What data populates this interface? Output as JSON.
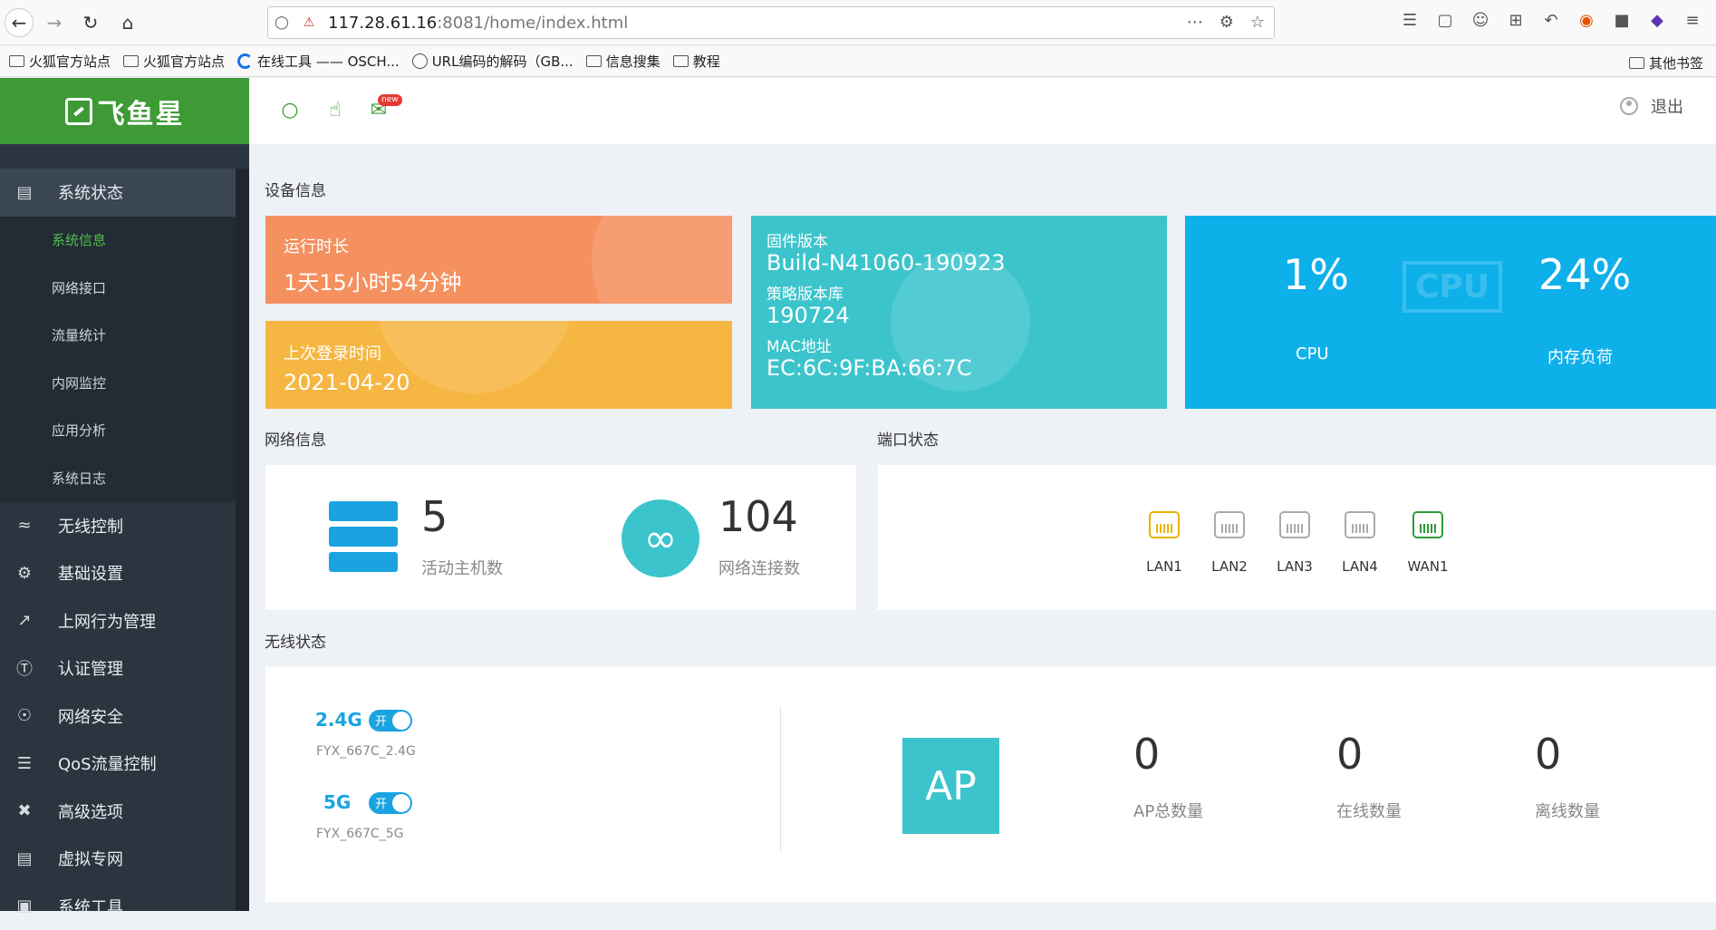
{
  "browser": {
    "url_host": "117.28.61.16",
    "url_rest": ":8081/home/index.html",
    "bookmarks": [
      {
        "label": "火狐官方站点",
        "icon": "folder-icon"
      },
      {
        "label": "火狐官方站点",
        "icon": "folder-icon"
      },
      {
        "label": "在线工具 —— OSCH...",
        "icon": "c-logo-icon"
      },
      {
        "label": "URL编码的解码（GB...",
        "icon": "globe-icon"
      },
      {
        "label": "信息搜集",
        "icon": "folder-icon"
      },
      {
        "label": "教程",
        "icon": "folder-icon"
      }
    ],
    "other_bookmarks": "其他书签"
  },
  "app": {
    "brand": "飞鱼星",
    "header": {
      "new_badge": "new",
      "logout": "退出"
    },
    "sidebar": {
      "items": [
        {
          "label": "系统状态",
          "icon": "monitor-icon"
        },
        {
          "label": "无线控制",
          "icon": "wifi-icon"
        },
        {
          "label": "基础设置",
          "icon": "gear-icon"
        },
        {
          "label": "上网行为管理",
          "icon": "chart-line-icon"
        },
        {
          "label": "认证管理",
          "icon": "v-circle-icon"
        },
        {
          "label": "网络安全",
          "icon": "shield-icon"
        },
        {
          "label": "QoS流量控制",
          "icon": "sliders-icon"
        },
        {
          "label": "高级选项",
          "icon": "tools-icon"
        },
        {
          "label": "虚拟专网",
          "icon": "vpn-icon"
        },
        {
          "label": "系统工具",
          "icon": "toolbox-icon"
        }
      ],
      "subitems": [
        "系统信息",
        "网络接口",
        "流量统计",
        "内网监控",
        "应用分析",
        "系统日志"
      ]
    },
    "device_info": {
      "title": "设备信息",
      "uptime_label": "运行时长",
      "uptime_value": "1天15小时54分钟",
      "last_login_label": "上次登录时间",
      "last_login_value": "2021-04-20",
      "firmware_label": "固件版本",
      "firmware_value": "Build-N41060-190923",
      "policy_label": "策略版本库",
      "policy_value": "190724",
      "mac_label": "MAC地址",
      "mac_value": "EC:6C:9F:BA:66:7C",
      "cpu_value": "1%",
      "cpu_label": "CPU",
      "mem_value": "24%",
      "mem_label": "内存负荷",
      "watermark": "CPU"
    },
    "network_info": {
      "title": "网络信息",
      "hosts_value": "5",
      "hosts_label": "活动主机数",
      "conn_value": "104",
      "conn_label": "网络连接数"
    },
    "port_status": {
      "title": "端口状态",
      "ports": [
        {
          "label": "LAN1",
          "state": "yellow"
        },
        {
          "label": "LAN2",
          "state": "off"
        },
        {
          "label": "LAN3",
          "state": "off"
        },
        {
          "label": "LAN4",
          "state": "off"
        },
        {
          "label": "WAN1",
          "state": "green"
        }
      ]
    },
    "wireless": {
      "title": "无线状态",
      "bands": [
        {
          "band": "2.4G",
          "toggle": "开",
          "ssid": "FYX_667C_2.4G"
        },
        {
          "band": "5G",
          "toggle": "开",
          "ssid": "FYX_667C_5G"
        }
      ],
      "ap_label": "AP",
      "ap_total_value": "0",
      "ap_total_label": "AP总数量",
      "online_value": "0",
      "online_label": "在线数量",
      "offline_value": "0",
      "offline_label": "离线数量"
    }
  }
}
